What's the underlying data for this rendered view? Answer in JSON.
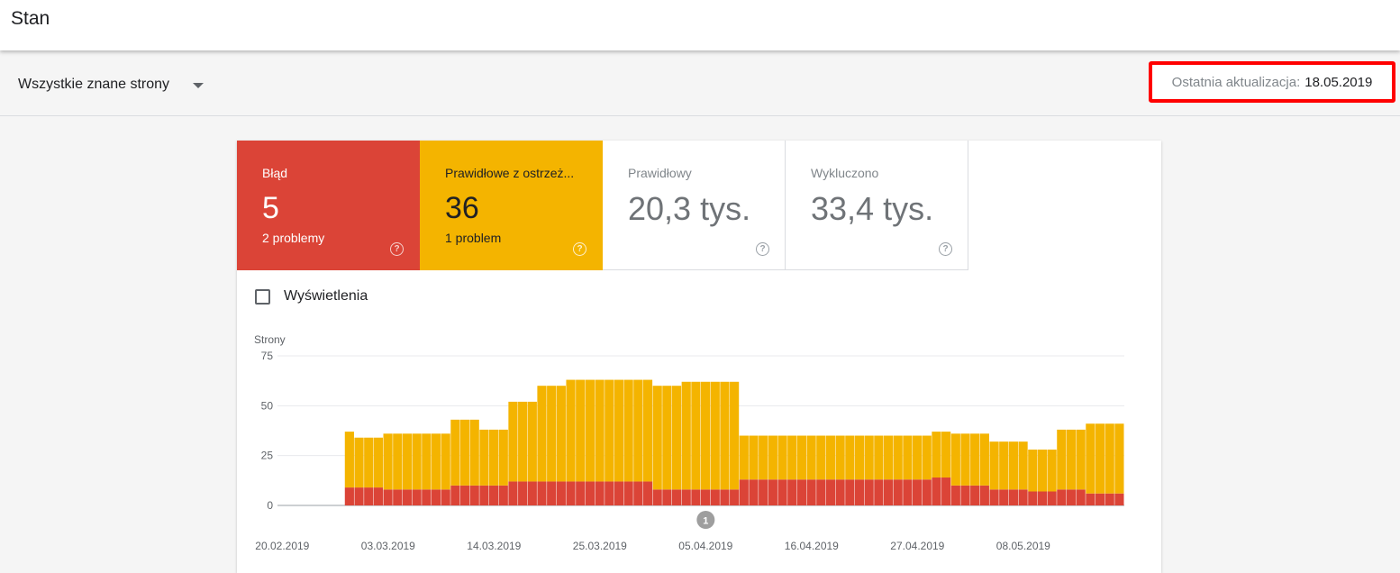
{
  "header": {
    "title": "Stan"
  },
  "filter": {
    "selected": "Wszystkie znane strony"
  },
  "update": {
    "label": "Ostatnia aktualizacja:",
    "date": "18.05.2019"
  },
  "tiles": [
    {
      "label": "Błąd",
      "value": "5",
      "sub": "2 problemy",
      "help": "?"
    },
    {
      "label": "Prawidłowe z ostrzeż...",
      "value": "36",
      "sub": "1 problem",
      "help": "?"
    },
    {
      "label": "Prawidłowy",
      "value": "20,3 tys.",
      "help": "?"
    },
    {
      "label": "Wykluczono",
      "value": "33,4 tys.",
      "help": "?"
    }
  ],
  "impressions": {
    "label": "Wyświetlenia",
    "checked": false
  },
  "colors": {
    "error": "#db4437",
    "warning": "#f4b400",
    "annotation": "#9e9e9e"
  },
  "chart_data": {
    "type": "bar",
    "stacked": true,
    "ylabel": "Strony",
    "ylim": [
      0,
      75
    ],
    "yticks": [
      0,
      25,
      50,
      75
    ],
    "xticks": [
      "20.02.2019",
      "03.03.2019",
      "14.03.2019",
      "25.03.2019",
      "05.04.2019",
      "16.04.2019",
      "27.04.2019",
      "08.05.2019"
    ],
    "x": [
      "20.02.2019",
      "21.02.2019",
      "22.02.2019",
      "23.02.2019",
      "24.02.2019",
      "25.02.2019",
      "26.02.2019",
      "27.02.2019",
      "28.02.2019",
      "01.03.2019",
      "02.03.2019",
      "03.03.2019",
      "04.03.2019",
      "05.03.2019",
      "06.03.2019",
      "07.03.2019",
      "08.03.2019",
      "09.03.2019",
      "10.03.2019",
      "11.03.2019",
      "12.03.2019",
      "13.03.2019",
      "14.03.2019",
      "15.03.2019",
      "16.03.2019",
      "17.03.2019",
      "18.03.2019",
      "19.03.2019",
      "20.03.2019",
      "21.03.2019",
      "22.03.2019",
      "23.03.2019",
      "24.03.2019",
      "25.03.2019",
      "26.03.2019",
      "27.03.2019",
      "28.03.2019",
      "29.03.2019",
      "30.03.2019",
      "31.03.2019",
      "01.04.2019",
      "02.04.2019",
      "03.04.2019",
      "04.04.2019",
      "05.04.2019",
      "06.04.2019",
      "07.04.2019",
      "08.04.2019",
      "09.04.2019",
      "10.04.2019",
      "11.04.2019",
      "12.04.2019",
      "13.04.2019",
      "14.04.2019",
      "15.04.2019",
      "16.04.2019",
      "17.04.2019",
      "18.04.2019",
      "19.04.2019",
      "20.04.2019",
      "21.04.2019",
      "22.04.2019",
      "23.04.2019",
      "24.04.2019",
      "25.04.2019",
      "26.04.2019",
      "27.04.2019",
      "28.04.2019",
      "29.04.2019",
      "30.04.2019",
      "01.05.2019",
      "02.05.2019",
      "03.05.2019",
      "04.05.2019",
      "05.05.2019",
      "06.05.2019",
      "07.05.2019",
      "08.05.2019",
      "09.05.2019",
      "10.05.2019",
      "11.05.2019",
      "12.05.2019",
      "13.05.2019",
      "14.05.2019",
      "15.05.2019",
      "16.05.2019",
      "17.05.2019",
      "18.05.2019"
    ],
    "series": [
      {
        "name": "Błąd",
        "values": [
          0,
          0,
          0,
          0,
          0,
          0,
          0,
          9,
          9,
          9,
          9,
          8,
          8,
          8,
          8,
          8,
          8,
          8,
          10,
          10,
          10,
          10,
          10,
          10,
          12,
          12,
          12,
          12,
          12,
          12,
          12,
          12,
          12,
          12,
          12,
          12,
          12,
          12,
          12,
          8,
          8,
          8,
          8,
          8,
          8,
          8,
          8,
          8,
          13,
          13,
          13,
          13,
          13,
          13,
          13,
          13,
          13,
          13,
          13,
          13,
          13,
          13,
          13,
          13,
          13,
          13,
          13,
          13,
          14,
          14,
          10,
          10,
          10,
          10,
          8,
          8,
          8,
          8,
          7,
          7,
          7,
          8,
          8,
          8,
          6,
          6,
          6,
          6
        ]
      },
      {
        "name": "Prawidłowe z ostrzeżeniami",
        "values": [
          0,
          0,
          0,
          0,
          0,
          0,
          0,
          28,
          25,
          25,
          25,
          28,
          28,
          28,
          28,
          28,
          28,
          28,
          33,
          33,
          33,
          28,
          28,
          28,
          40,
          40,
          40,
          48,
          48,
          48,
          51,
          51,
          51,
          51,
          51,
          51,
          51,
          51,
          51,
          52,
          52,
          52,
          54,
          54,
          54,
          54,
          54,
          54,
          22,
          22,
          22,
          22,
          22,
          22,
          22,
          22,
          22,
          22,
          22,
          22,
          22,
          22,
          22,
          22,
          22,
          22,
          22,
          22,
          23,
          23,
          26,
          26,
          26,
          26,
          24,
          24,
          24,
          24,
          21,
          21,
          21,
          30,
          30,
          30,
          35,
          35,
          35,
          35
        ]
      }
    ],
    "annotations": [
      {
        "label": "1",
        "x": "05.04.2019"
      }
    ]
  }
}
